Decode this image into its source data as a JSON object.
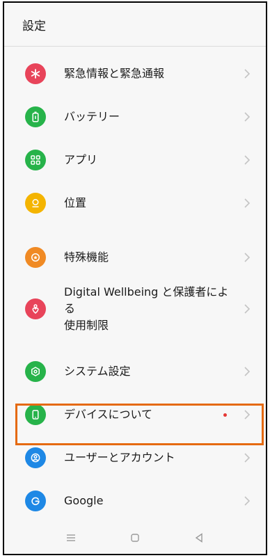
{
  "header": {
    "title": "設定"
  },
  "settings": {
    "items": [
      {
        "label": "緊急情報と緊急通報",
        "color": "#e8445a",
        "icon": "asterisk-icon"
      },
      {
        "label": "バッテリー",
        "color": "#27b34a",
        "icon": "battery-icon"
      },
      {
        "label": "アプリ",
        "color": "#27b34a",
        "icon": "apps-grid-icon"
      },
      {
        "label": "位置",
        "color": "#f4b400",
        "icon": "location-pin-icon"
      },
      {
        "label": "特殊機能",
        "color": "#f08a24",
        "icon": "star-badge-icon"
      },
      {
        "label": "Digital Wellbeing と保護者による使用制限",
        "line1": "Digital Wellbeing と保護者による",
        "line2": "使用制限",
        "color": "#e8445a",
        "icon": "wellbeing-heart-icon"
      },
      {
        "label": "システム設定",
        "color": "#27b34a",
        "icon": "system-gear-icon"
      },
      {
        "label": "デバイスについて",
        "color": "#27b34a",
        "icon": "phone-device-icon",
        "badge": "red-dot"
      },
      {
        "label": "ユーザーとアカウント",
        "color": "#1e88e5",
        "icon": "user-account-icon"
      },
      {
        "label": "Google",
        "color": "#1e88e5",
        "icon": "google-g-icon"
      }
    ]
  },
  "colors": {
    "highlight": "#e56a11",
    "badge": "#e53935"
  }
}
